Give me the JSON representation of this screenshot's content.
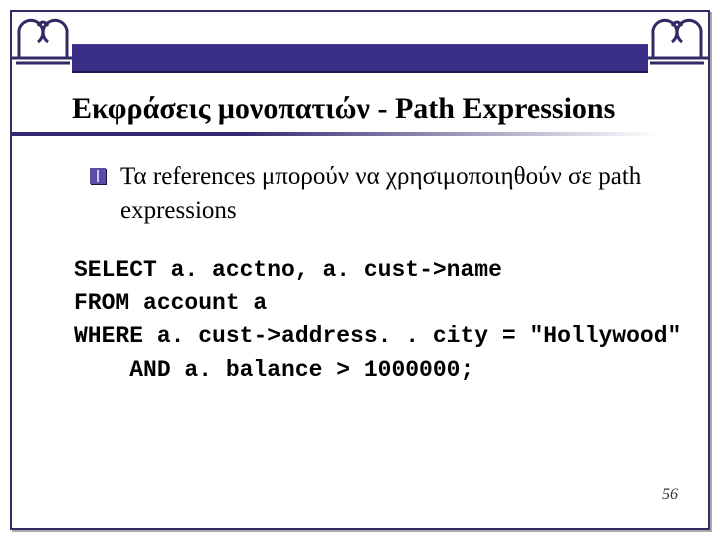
{
  "title": "Εκφράσεις μονοπατιών - Path Expressions",
  "bullet": "Τα references μπορούν να χρησιμοποιηθούν σε path expressions",
  "code": {
    "l1a": "SELECT a. acctno, a. cust",
    "l1b": "->",
    "l1c": "name",
    "l2": "FROM account a",
    "l3a": "WHERE a. cust",
    "l3b": "->",
    "l3c": "address. . city = \"Hollywood\"",
    "l4": "    AND a. balance > 1000000;"
  },
  "page": "56"
}
